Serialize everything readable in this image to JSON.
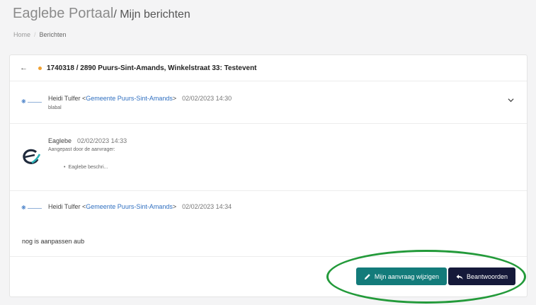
{
  "header": {
    "title_main": "Eaglebe Portaal",
    "title_sub": "/ Mijn berichten"
  },
  "breadcrumb": {
    "home": "Home",
    "separator": "/",
    "current": "Berichten"
  },
  "thread": {
    "subject": "1740318 / 2890 Puurs-Sint-Amands, Winkelstraat 33: Testevent",
    "status_color": "#f0a030",
    "messages": [
      {
        "sender": "Heidi Tulfer <",
        "org": "Gemeente Puurs-Sint-Amands",
        "org_close": ">",
        "date": "02/02/2023 14:30",
        "body": "blabal"
      },
      {
        "sender": "Eaglebe",
        "date": "02/02/2023 14:33",
        "body": "Aangepast door de aanvrager:",
        "items": [
          "Eaglebe beschri..."
        ]
      },
      {
        "sender": "Heidi Tulfer <",
        "org": "Gemeente Puurs-Sint-Amands",
        "org_close": ">",
        "date": "02/02/2023 14:34",
        "body": "nog is aanpassen aub"
      }
    ]
  },
  "actions": {
    "edit_label": "Mijn aanvraag wijzigen",
    "reply_label": "Beantwoorden"
  },
  "colors": {
    "edit_button": "#137b7a",
    "reply_button": "#15193a",
    "highlight": "#239a3a",
    "link": "#2f6fc0"
  }
}
